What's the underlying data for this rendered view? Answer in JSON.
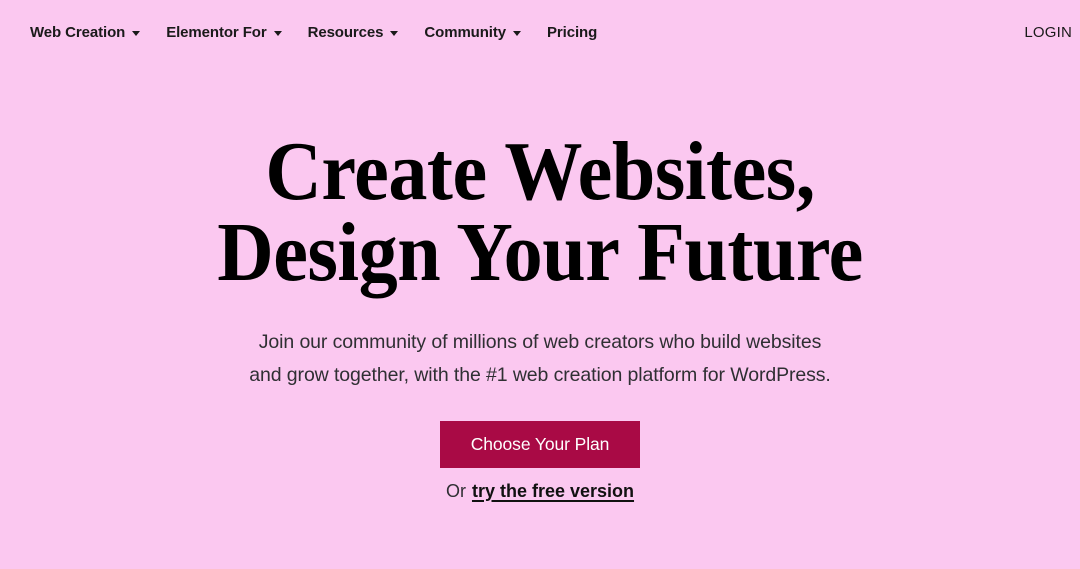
{
  "theme": {
    "background": "#fbc8f0",
    "text": "#1a1a1a",
    "accent": "#a90a45",
    "button_text": "#ffffff"
  },
  "nav": {
    "items": [
      {
        "label": "Web Creation",
        "has_dropdown": true,
        "icon": "chevron-down-icon"
      },
      {
        "label": "Elementor For",
        "has_dropdown": true,
        "icon": "chevron-down-icon"
      },
      {
        "label": "Resources",
        "has_dropdown": true,
        "icon": "chevron-down-icon"
      },
      {
        "label": "Community",
        "has_dropdown": true,
        "icon": "chevron-down-icon"
      },
      {
        "label": "Pricing",
        "has_dropdown": false,
        "icon": ""
      }
    ],
    "login_label": "LOGIN"
  },
  "hero": {
    "headline_line1": "Create Websites,",
    "headline_line2": "Design Your Future",
    "subtitle_line1": "Join our community of millions of web creators who build websites",
    "subtitle_line2": "and grow together, with the #1 web creation platform for WordPress.",
    "cta_label": "Choose Your Plan",
    "free_prefix": "Or",
    "free_link_label": "try the free version"
  }
}
